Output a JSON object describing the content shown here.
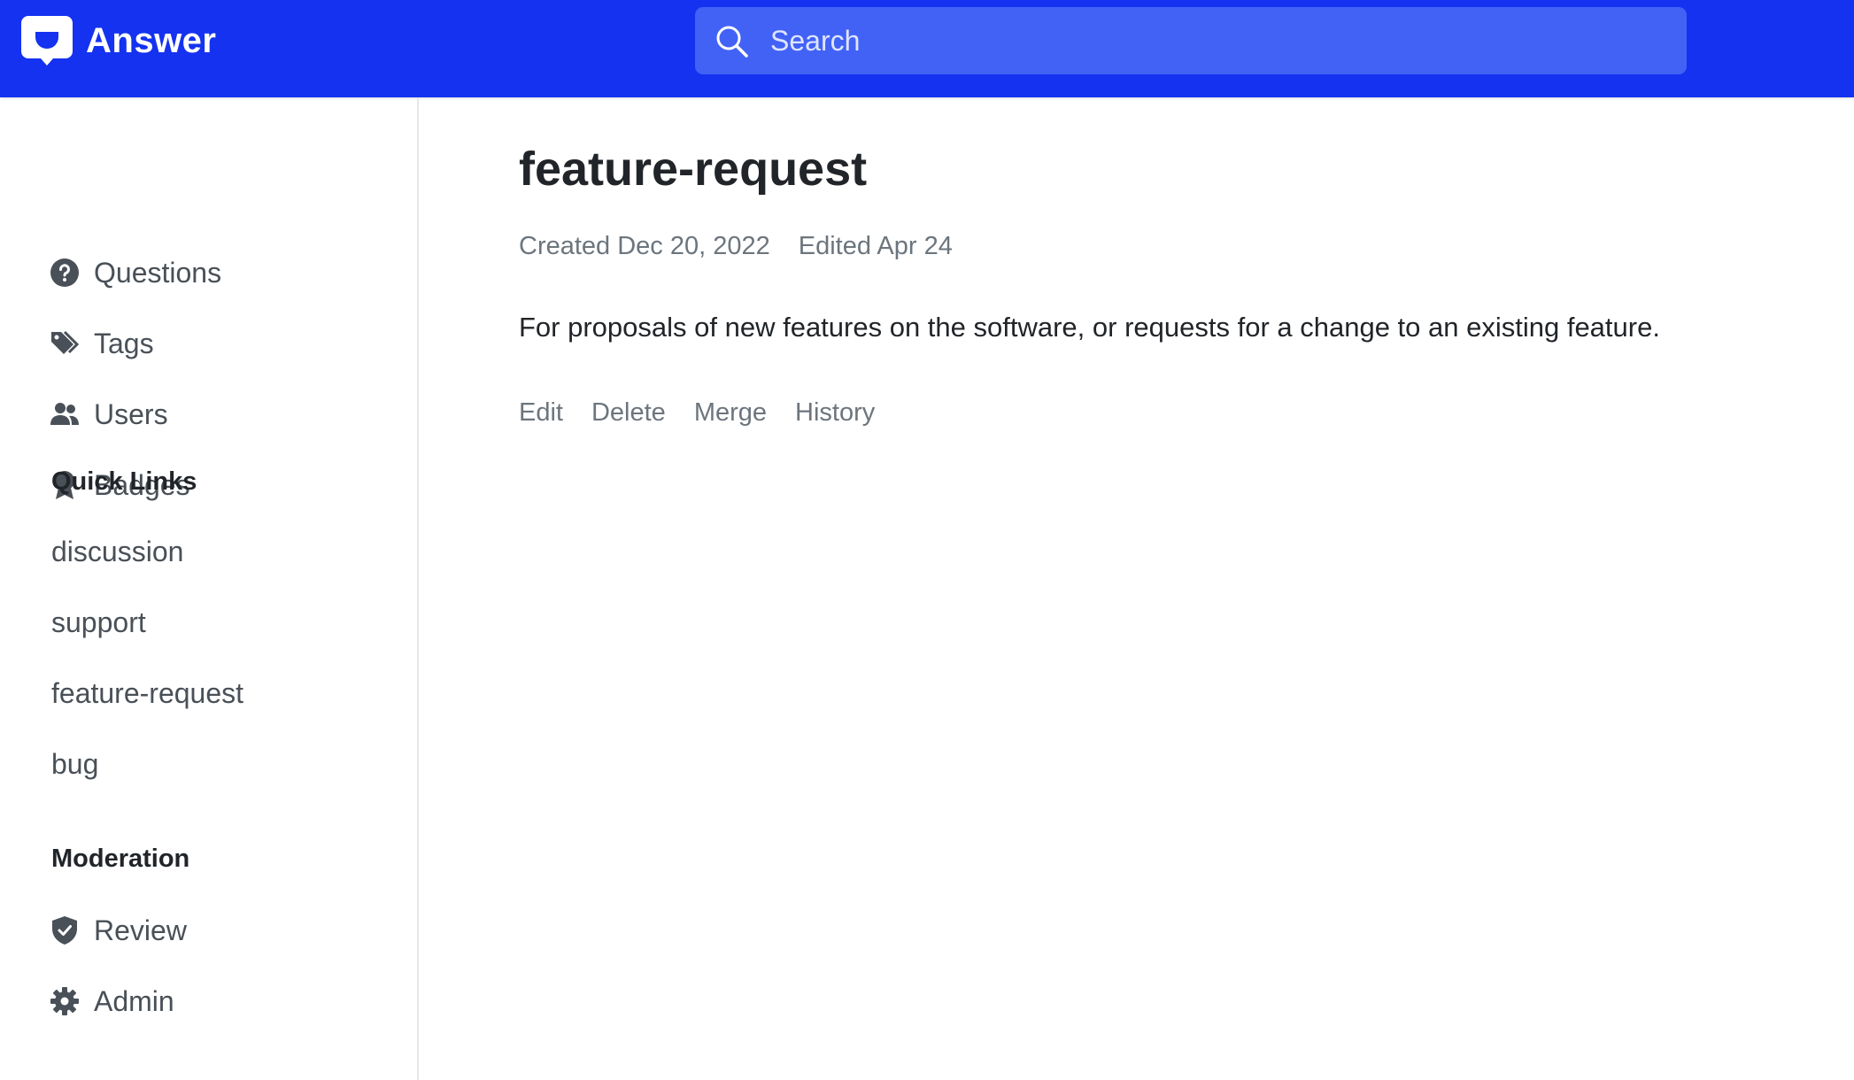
{
  "header": {
    "brand_name": "Answer",
    "brand_color": "#1432f0",
    "logo_icon": "answer-logo-icon",
    "search": {
      "placeholder": "Search",
      "value": "",
      "icon": "search-icon"
    }
  },
  "sidebar": {
    "nav": [
      {
        "label": "Questions",
        "icon": "question-circle-icon"
      },
      {
        "label": "Tags",
        "icon": "tags-icon"
      },
      {
        "label": "Users",
        "icon": "people-icon"
      },
      {
        "label": "Badges",
        "icon": "award-icon"
      }
    ],
    "quick_links": {
      "title": "Quick Links",
      "items": [
        "discussion",
        "support",
        "feature-request",
        "bug"
      ]
    },
    "moderation": {
      "title": "Moderation",
      "items": [
        {
          "label": "Review",
          "icon": "shield-check-icon"
        },
        {
          "label": "Admin",
          "icon": "gear-icon"
        }
      ]
    }
  },
  "tag": {
    "title": "feature-request",
    "created": "Created Dec 20, 2022",
    "edited": "Edited Apr 24",
    "description": "For proposals of new features on the software, or requests for a change to an existing feature.",
    "actions": {
      "edit": "Edit",
      "delete": "Delete",
      "merge": "Merge",
      "history": "History"
    }
  }
}
